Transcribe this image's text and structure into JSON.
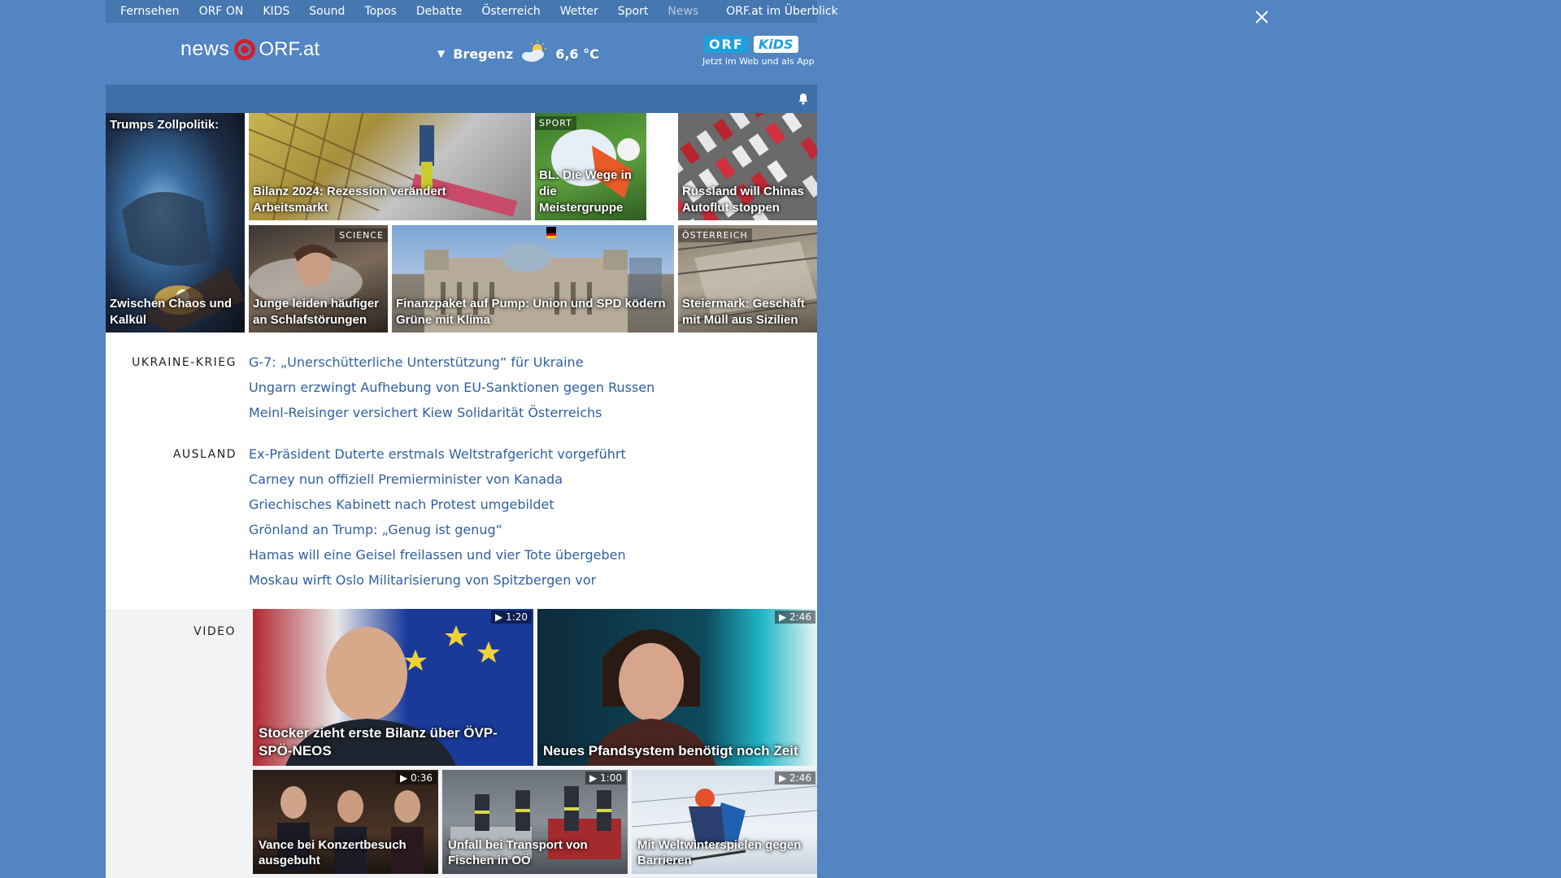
{
  "topnav": {
    "items": [
      "Fernsehen",
      "ORF ON",
      "KIDS",
      "Sound",
      "Topos",
      "Debatte",
      "Österreich",
      "Wetter",
      "Sport",
      "News"
    ],
    "active": "News",
    "overview": "ORF.at im Überblick"
  },
  "header": {
    "logo_news": "news",
    "logo_orf": "ORF.at",
    "weather": {
      "city": "Bregenz",
      "temp": "6,6 °C"
    },
    "kids": {
      "orf": "ORF",
      "kids": "KiDS",
      "tagline": "Jetzt im Web und als App"
    }
  },
  "tiles": [
    {
      "title": "Trumps Zollpolitik:",
      "title2": "Zwischen Chaos und Kalkül",
      "tag": ""
    },
    {
      "title": "Bilanz 2024: Rezession verändert Arbeitsmarkt",
      "tag": ""
    },
    {
      "title": "BL: Die Wege in die Meistergruppe",
      "tag": "SPORT"
    },
    {
      "title": "Russland will Chinas Autoflut stoppen",
      "tag": ""
    },
    {
      "title": "Junge leiden häufiger an Schlafstörungen",
      "tag": "SCIENCE"
    },
    {
      "title": "Finanzpaket auf Pump: Union und SPD ködern Grüne mit Klima",
      "tag": ""
    },
    {
      "title": "Steiermark: Geschäft mit Müll aus Sizilien",
      "tag": "ÖSTERREICH"
    }
  ],
  "sections": [
    {
      "label": "UKRAINE-KRIEG",
      "items": [
        "G-7: „Unerschütterliche Unterstützung“ für Ukraine",
        "Ungarn erzwingt Aufhebung von EU-Sanktionen gegen Russen",
        "Meinl-Reisinger versichert Kiew Solidarität Österreichs"
      ]
    },
    {
      "label": "AUSLAND",
      "items": [
        "Ex-Präsident Duterte erstmals Weltstrafgericht vorgeführt",
        "Carney nun offiziell Premierminister von Kanada",
        "Griechisches Kabinett nach Protest umgebildet",
        "Grönland an Trump: „Genug ist genug“",
        "Hamas will eine Geisel freilassen und vier Tote übergeben",
        "Moskau wirft Oslo Militarisierung von Spitzbergen vor"
      ]
    }
  ],
  "video": {
    "label": "VIDEO",
    "items": [
      {
        "title": "Stocker zieht erste Bilanz über ÖVP-SPÖ-NEOS",
        "duration": "1:20"
      },
      {
        "title": "Neues Pfandsystem benötigt noch Zeit",
        "duration": "2:46"
      },
      {
        "title": "Vance bei Konzertbesuch ausgebuht",
        "duration": "0:36"
      },
      {
        "title": "Unfall bei Transport von Fischen in OÖ",
        "duration": "1:00"
      },
      {
        "title": "Mit Weltwinterspielen gegen Barrieren",
        "duration": "2:46"
      }
    ]
  },
  "colors": {
    "page_bg": "#5285c2",
    "nav_bg": "#4577b0",
    "link": "#2f60a4",
    "orf_red": "#d0202c"
  }
}
